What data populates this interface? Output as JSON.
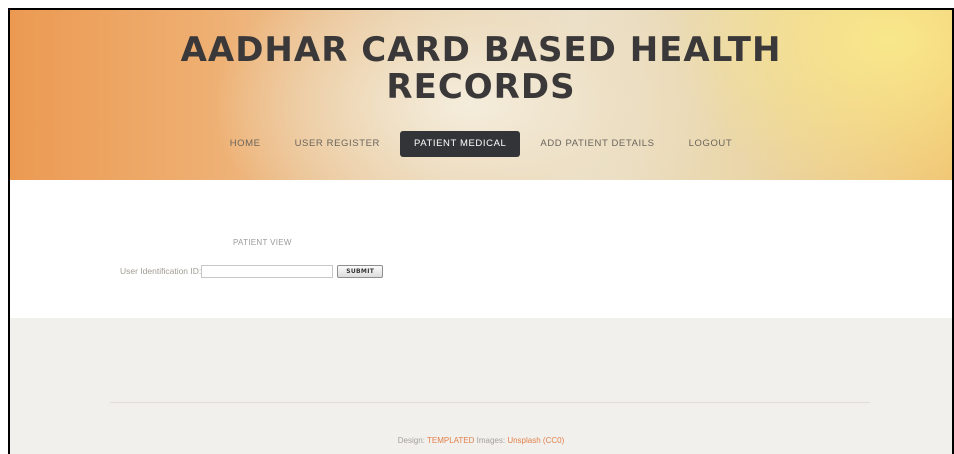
{
  "header": {
    "title_line1": "AADHAR CARD BASED HEALTH",
    "title_line2": "RECORDS"
  },
  "nav": {
    "items": [
      {
        "label": "HOME",
        "active": false
      },
      {
        "label": "USER REGISTER",
        "active": false
      },
      {
        "label": "PATIENT MEDICAL",
        "active": true
      },
      {
        "label": "ADD PATIENT DETAILS",
        "active": false
      },
      {
        "label": "LOGOUT",
        "active": false
      }
    ]
  },
  "main": {
    "panel_title": "PATIENT VIEW",
    "form": {
      "id_label": "User Identification ID:",
      "id_value": "",
      "id_placeholder": "",
      "submit_label": "SUBMIT"
    }
  },
  "footer": {
    "design_prefix": "Design:",
    "design_link": "TEMPLATED",
    "images_prefix": "Images:",
    "images_link": "Unsplash (CC0)"
  },
  "colors": {
    "active_nav_bg": "#333437",
    "link_accent": "#e2804a",
    "footer_bg": "#f1f0ed"
  }
}
